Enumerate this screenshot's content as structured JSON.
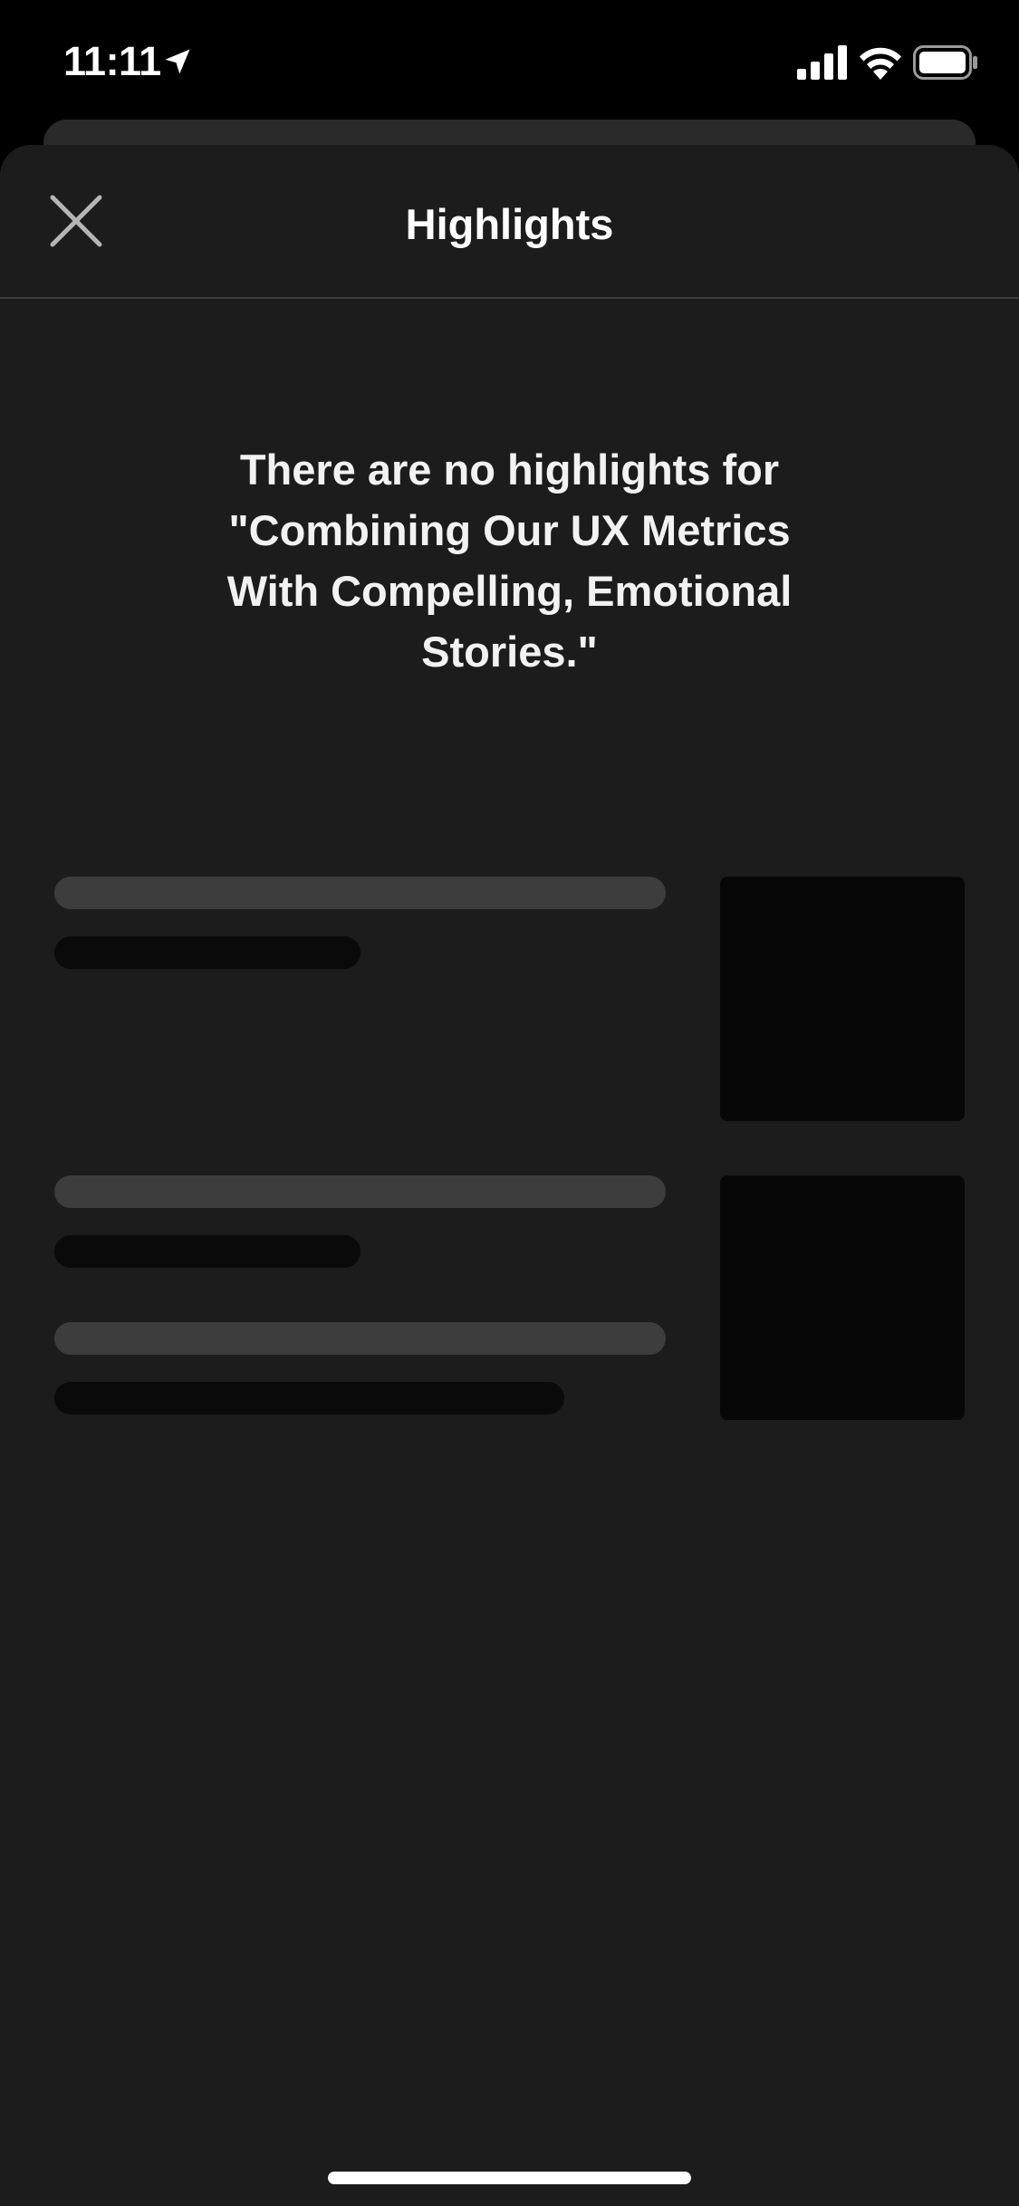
{
  "status_bar": {
    "time": "11:11",
    "icons": [
      "location-arrow-icon",
      "cellular-signal-icon",
      "wifi-icon",
      "battery-icon"
    ]
  },
  "sheet": {
    "title": "Highlights",
    "close_icon": "close-icon",
    "empty_message": "There are no highlights for \"Combining Our UX Metrics With Compelling, Emotional Stories.\""
  },
  "colors": {
    "background": "#000000",
    "sheet_background": "#1c1c1c",
    "skeleton_light": "#3d3d3d",
    "skeleton_dark": "#0a0a0a",
    "text": "#ffffff"
  }
}
